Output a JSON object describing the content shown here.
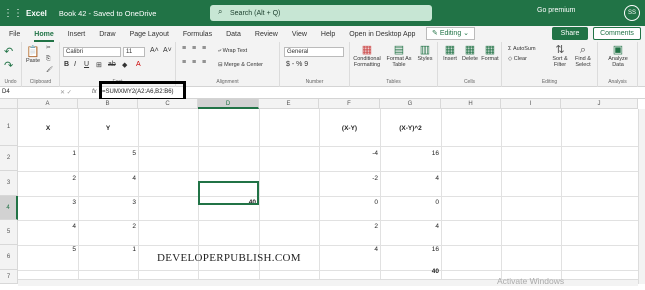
{
  "titlebar": {
    "app": "Excel",
    "doc": "Book 42 - Saved to OneDrive",
    "search_placeholder": "Search (Alt + Q)",
    "premium": "Go premium",
    "avatar": "SS"
  },
  "tabs": [
    "File",
    "Home",
    "Insert",
    "Draw",
    "Page Layout",
    "Formulas",
    "Data",
    "Review",
    "View",
    "Help",
    "Open in Desktop App"
  ],
  "editing_label": "Editing",
  "share_label": "Share",
  "comments_label": "Comments",
  "ribbon": {
    "undo": "Undo",
    "paste": "Paste",
    "clipboard": "Clipboard",
    "font_name": "Calibri",
    "font_size": "11",
    "font_group": "Font",
    "wrap_text": "Wrap Text",
    "merge_center": "Merge & Center",
    "alignment": "Alignment",
    "number_format": "General",
    "number_symbols": "$ - % 9",
    "number": "Number",
    "conditional": "Conditional Formatting",
    "format_table": "Format As Table",
    "styles": "Styles",
    "tables": "Tables",
    "insert": "Insert",
    "delete": "Delete",
    "format": "Format",
    "cells": "Cells",
    "autosum": "AutoSum",
    "clear": "Clear",
    "sort_filter": "Sort & Filter",
    "find_select": "Find & Select",
    "editing": "Editing",
    "analyze": "Analyze Data",
    "analysis": "Analysis"
  },
  "formula_bar": {
    "name_box": "D4",
    "fx": "fx",
    "formula": "=SUMXMY2(A2:A6,B2:B6)"
  },
  "columns": [
    "A",
    "B",
    "C",
    "D",
    "E",
    "F",
    "G",
    "H",
    "I",
    "J"
  ],
  "rows": [
    "1",
    "2",
    "3",
    "4",
    "5",
    "6",
    "7"
  ],
  "cells": {
    "A1": "X",
    "B1": "Y",
    "F1": "(X-Y)",
    "G1": "(X-Y)^2",
    "A2": "1",
    "B2": "5",
    "F2": "-4",
    "G2": "16",
    "A3": "2",
    "B3": "4",
    "F3": "-2",
    "G3": "4",
    "A4": "3",
    "B4": "3",
    "D4": "40",
    "F4": "0",
    "G4": "0",
    "A5": "4",
    "B5": "2",
    "F5": "2",
    "G5": "4",
    "A6": "5",
    "B6": "1",
    "F6": "4",
    "G6": "16",
    "G7": "40"
  },
  "watermark": "DEVELOPERPUBLISH.COM",
  "activate_windows": "Activate Windows",
  "colors": {
    "excel_green": "#217346"
  }
}
